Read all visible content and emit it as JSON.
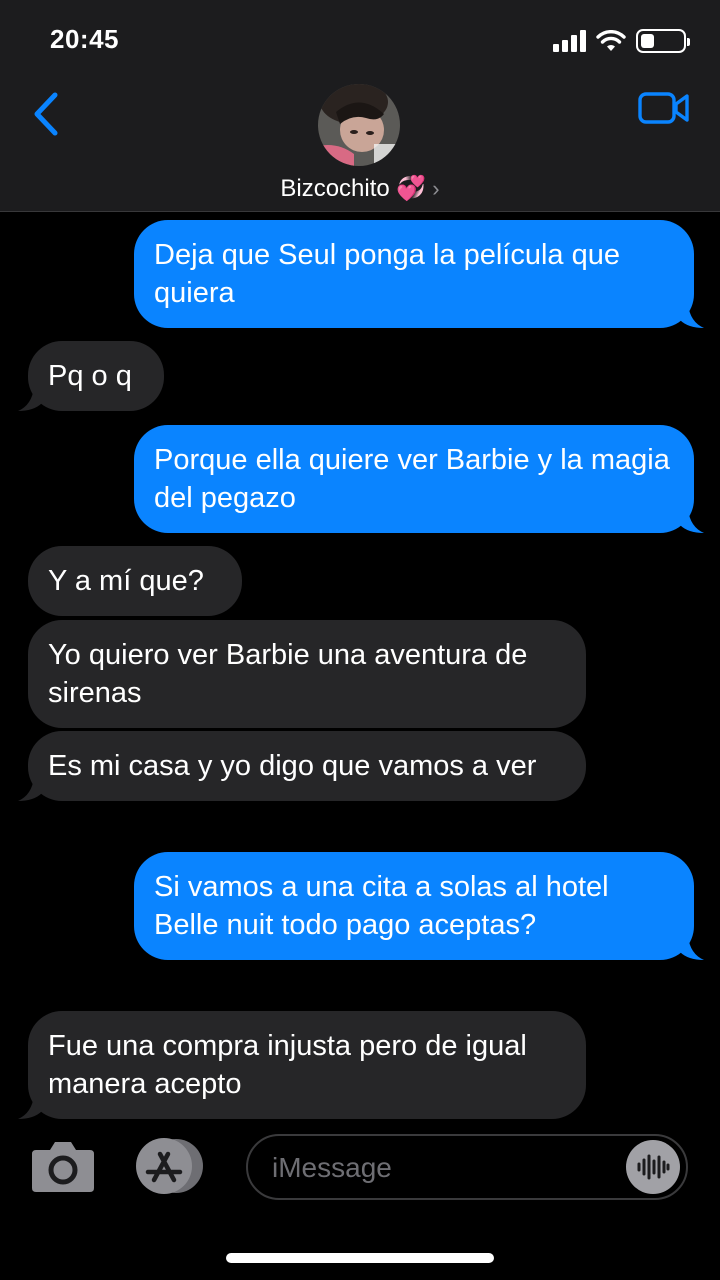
{
  "status_bar": {
    "time": "20:45"
  },
  "header": {
    "contact_name": "Bizcochito 💞",
    "chevron": "›"
  },
  "icons": {
    "back": "chevron-left-icon",
    "video": "video-camera-icon",
    "camera": "camera-icon",
    "apps": "app-store-icon",
    "audio": "waveform-icon"
  },
  "colors": {
    "accent": "#0a84ff",
    "incoming_bubble": "#262628",
    "header_bg": "#1c1c1e"
  },
  "messages": [
    {
      "direction": "out",
      "text": "Deja que Seul ponga la película que quiera"
    },
    {
      "direction": "in",
      "text": "Pq o q"
    },
    {
      "direction": "out",
      "text": "Porque ella quiere ver Barbie y la magia del pegazo"
    },
    {
      "direction": "in",
      "text": "Y a mí que?"
    },
    {
      "direction": "in",
      "text": "Yo quiero ver Barbie una aventura de sirenas"
    },
    {
      "direction": "in",
      "text": "Es mi casa y yo digo que vamos a ver"
    },
    {
      "direction": "out",
      "text": "Si vamos a una cita a solas al hotel Belle nuit todo pago aceptas?"
    },
    {
      "direction": "in",
      "text": "Fue una compra injusta pero de igual manera acepto"
    }
  ],
  "composer": {
    "placeholder": "iMessage"
  }
}
